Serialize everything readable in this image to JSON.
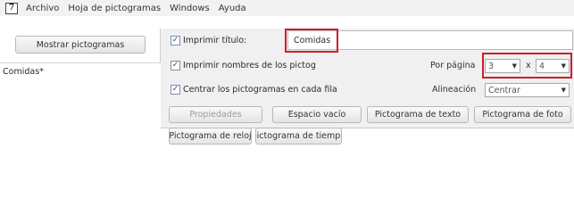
{
  "menubar": {
    "app_icon": "app-logo-icon",
    "app_icon_glyph": "7",
    "items": [
      "Archivo",
      "Hoja de pictogramas",
      "Windows",
      "Ayuda"
    ]
  },
  "left_panel": {
    "show_button_label": "Mostrar pictogramas",
    "list_items": [
      "Comidas*"
    ]
  },
  "options": {
    "print_title_label": "Imprimir título:",
    "print_title_checked": true,
    "title_value": "Comidas",
    "print_names_label": "Imprimir nombres de los pictog",
    "print_names_checked": true,
    "center_label": "Centrar los pictogramas en cada fila",
    "center_checked": true,
    "per_page_label": "Por página",
    "rows_value": "3",
    "times_symbol": "x",
    "cols_value": "4",
    "alignment_label": "Alineación",
    "alignment_value": "Centrar",
    "check_glyph": "✓",
    "dropdown_glyph": "▼"
  },
  "buttons": {
    "properties": "Propiedades",
    "empty_space": "Espacio vacío",
    "text_pictogram": "Pictograma de texto",
    "photo_pictogram": "Pictograma de foto",
    "clock_pictogram": "Pictograma de reloj",
    "time_pictogram": "ictograma de tiemp"
  },
  "colors": {
    "highlight": "#cc1f2a",
    "panel_bg": "#f0f0f0"
  }
}
